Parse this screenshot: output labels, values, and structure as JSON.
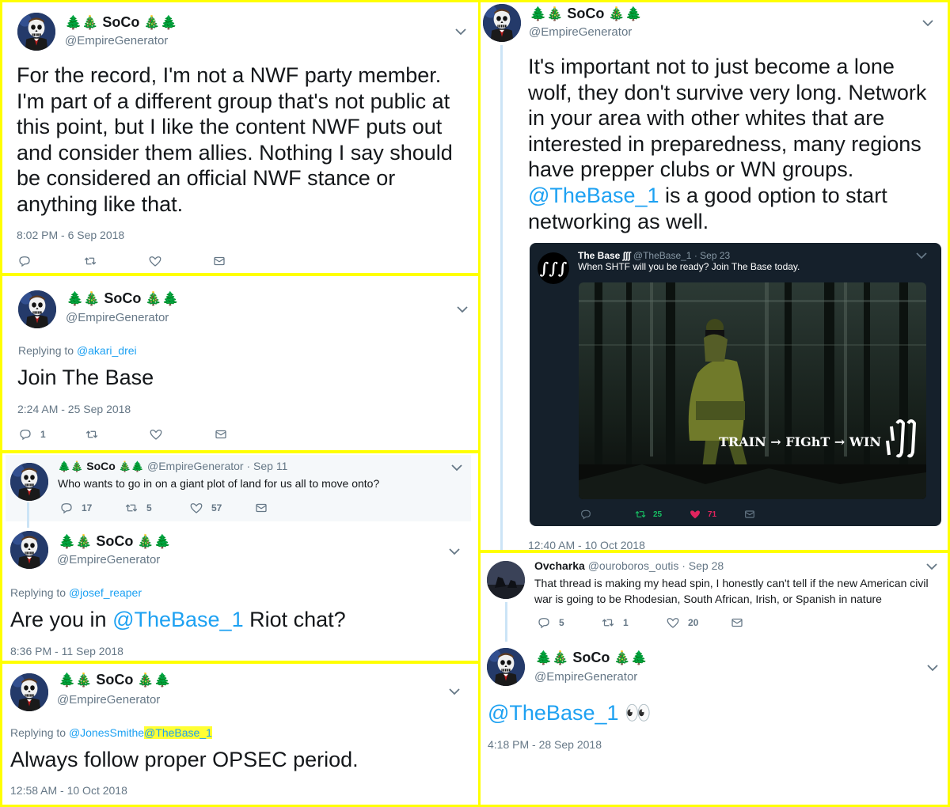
{
  "tweet1": {
    "name": "SoCo",
    "handle": "@EmpireGenerator",
    "body": "For the record, I'm not a NWF party member. I'm part of a different group that's not public at this point, but I like the content NWF puts out and consider them allies. Nothing I say should be considered an official NWF stance or anything like that.",
    "timestamp": "8:02 PM - 6 Sep 2018"
  },
  "tweet2": {
    "name": "SoCo",
    "handle": "@EmpireGenerator",
    "replying_prefix": "Replying to",
    "replying_to": "@akari_drei",
    "body": "Join The Base",
    "timestamp": "2:24 AM - 25 Sep 2018",
    "reply_count": "1"
  },
  "tweet3": {
    "parent": {
      "name": "SoCo",
      "handle": "@EmpireGenerator",
      "date": "· Sep 11",
      "body": "Who wants to go in on a giant plot of land for us all to move onto?",
      "replies": "17",
      "retweets": "5",
      "likes": "57"
    },
    "name": "SoCo",
    "handle": "@EmpireGenerator",
    "replying_prefix": "Replying to",
    "replying_to": "@josef_reaper",
    "body_pre": "Are you in ",
    "body_mention": "@TheBase_1",
    "body_post": " Riot chat?",
    "timestamp": "8:36 PM - 11 Sep 2018"
  },
  "tweet4": {
    "name": "SoCo",
    "handle": "@EmpireGenerator",
    "replying_prefix": "Replying to",
    "replying_to": "@JonesSmithe",
    "replying_to_2": "@TheBase_1",
    "body": "Always follow proper OPSEC period.",
    "timestamp": "12:58 AM - 10 Oct 2018"
  },
  "tweet5": {
    "name": "SoCo",
    "handle": "@EmpireGenerator",
    "body_pre": "It's important not to just become a lone wolf, they don't survive very long. Network in your area with other whites that are interested in preparedness, many regions have prepper clubs or WN groups. ",
    "body_mention": "@TheBase_1",
    "body_post": " is a good option to start networking as well.",
    "timestamp": "12:40 AM - 10 Oct 2018",
    "quoted": {
      "name": "The Base ∫∫∫",
      "handle": "@TheBase_1",
      "date": "· Sep 23",
      "body": "When SHTF will you be ready? Join The Base today.",
      "image_caption": "TRAIN → FIGhT → WIN",
      "retweets": "25",
      "likes": "71"
    }
  },
  "tweet6": {
    "parent": {
      "name": "Ovcharka",
      "handle": "@ouroboros_outis",
      "date": "· Sep 28",
      "body": "That thread is making my head spin, I honestly can't tell if the new American civil war is going to be Rhodesian, South African, Irish, or Spanish in nature",
      "replies": "5",
      "retweets": "1",
      "likes": "20"
    },
    "name": "SoCo",
    "handle": "@EmpireGenerator",
    "body_mention": "@TheBase_1",
    "body_emoji": "👀",
    "timestamp": "4:18 PM - 28 Sep 2018"
  },
  "icons": {
    "tree": "🌲",
    "xmas": "🎄",
    "chevron": "chevron-down-icon",
    "reply": "reply-icon",
    "retweet": "retweet-icon",
    "like": "heart-icon",
    "dm": "envelope-icon"
  },
  "colors": {
    "border": "#ffff00",
    "link": "#1da1f2",
    "muted": "#657786",
    "dark_card": "#15202b",
    "retweet_green": "#17bf63",
    "like_red": "#e0245e"
  }
}
